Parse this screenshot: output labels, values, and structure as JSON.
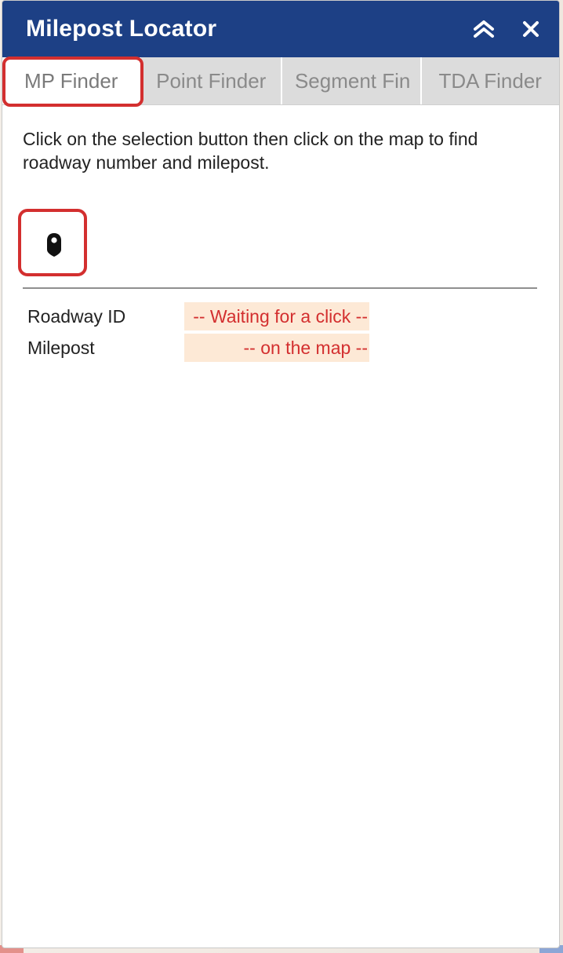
{
  "panel": {
    "title": "Milepost Locator"
  },
  "icons": {
    "collapse": "double-chevron-up-icon",
    "close": "close-icon",
    "pin": "map-pin-icon"
  },
  "tabs": [
    {
      "label": "MP Finder",
      "active": true
    },
    {
      "label": "Point Finder",
      "active": false
    },
    {
      "label": "Segment Fin",
      "active": false
    },
    {
      "label": "TDA Finder",
      "active": false
    }
  ],
  "instructions": "Click on the selection button then click on the map to find roadway number and milepost.",
  "results": {
    "roadway_label": "Roadway ID",
    "roadway_value": "-- Waiting for a click --",
    "milepost_label": "Milepost",
    "milepost_value": "-- on the map --"
  },
  "colors": {
    "header_bg": "#1d4085",
    "highlight": "#d32f2f",
    "value_bg": "#fde9d6",
    "value_text": "#d32f2f"
  }
}
